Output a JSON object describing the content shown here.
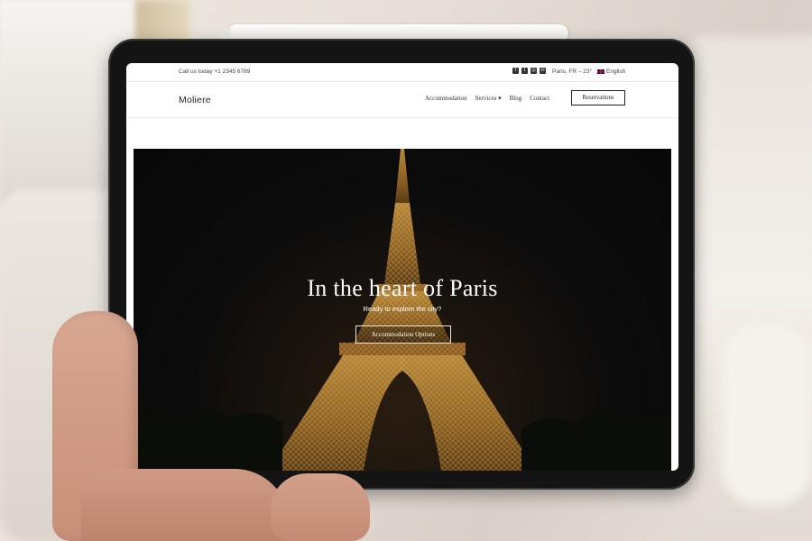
{
  "topbar": {
    "call_text": "Call us today +1 2345 6789",
    "social_icons": [
      "facebook-icon",
      "twitter-icon",
      "instagram-icon",
      "email-icon"
    ],
    "weather": "Paris, FR – 23°",
    "language": "English"
  },
  "nav": {
    "logo": "Moliere",
    "items": [
      {
        "label": "Accommodation"
      },
      {
        "label": "Services ▾"
      },
      {
        "label": "Blog"
      },
      {
        "label": "Contact"
      }
    ],
    "reserve_label": "Reservations"
  },
  "hero": {
    "title": "In the heart of Paris",
    "subtitle": "Ready to explore the city?",
    "button_label": "Accommodation Options"
  },
  "colors": {
    "hero_bg": "#0d0c0c",
    "tower_light": "#c9953f",
    "tablet_frame": "#141414"
  }
}
